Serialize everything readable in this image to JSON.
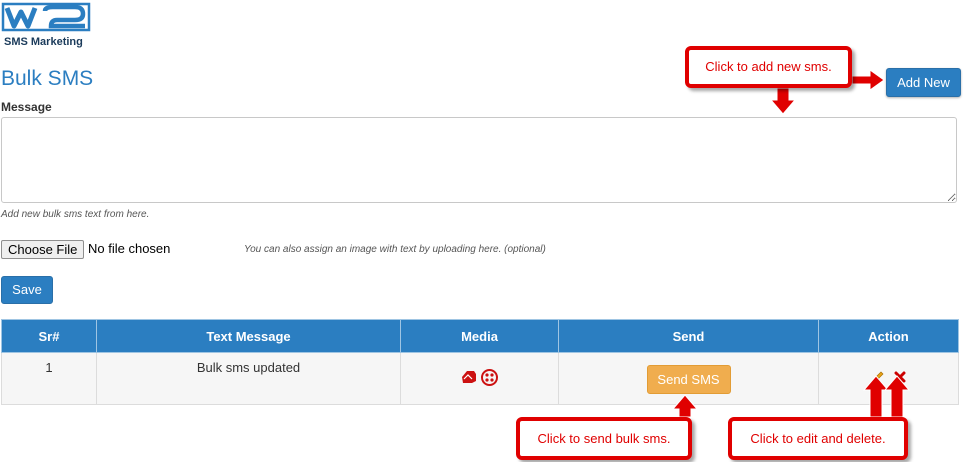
{
  "logo": {
    "mark": "W2",
    "text": "SMS Marketing"
  },
  "page": {
    "title": "Bulk SMS"
  },
  "form": {
    "message_label": "Message",
    "message_value": "",
    "message_help": "Add new bulk sms text from here.",
    "file_button": "Choose File",
    "file_status": "No file chosen",
    "file_help": "You can also assign an image with text by uploading here. (optional)",
    "save_label": "Save"
  },
  "header": {
    "add_new_label": "Add New"
  },
  "table": {
    "columns": [
      "Sr#",
      "Text Message",
      "Media",
      "Send",
      "Action"
    ],
    "rows": [
      {
        "sr": "1",
        "text": "Bulk sms updated",
        "media_icons": [
          "image-icon",
          "flower-icon"
        ],
        "send_label": "Send SMS",
        "actions": [
          "edit-icon",
          "delete-icon"
        ]
      }
    ]
  },
  "callouts": {
    "add": "Click to add new sms.",
    "send": "Click to send bulk sms.",
    "edit_delete": "Click to edit and delete."
  },
  "colors": {
    "primary": "#2b7ec1",
    "warning": "#f0ad4e",
    "callout": "#e00000",
    "delete": "#cc0000",
    "edit": "#e8a317"
  }
}
